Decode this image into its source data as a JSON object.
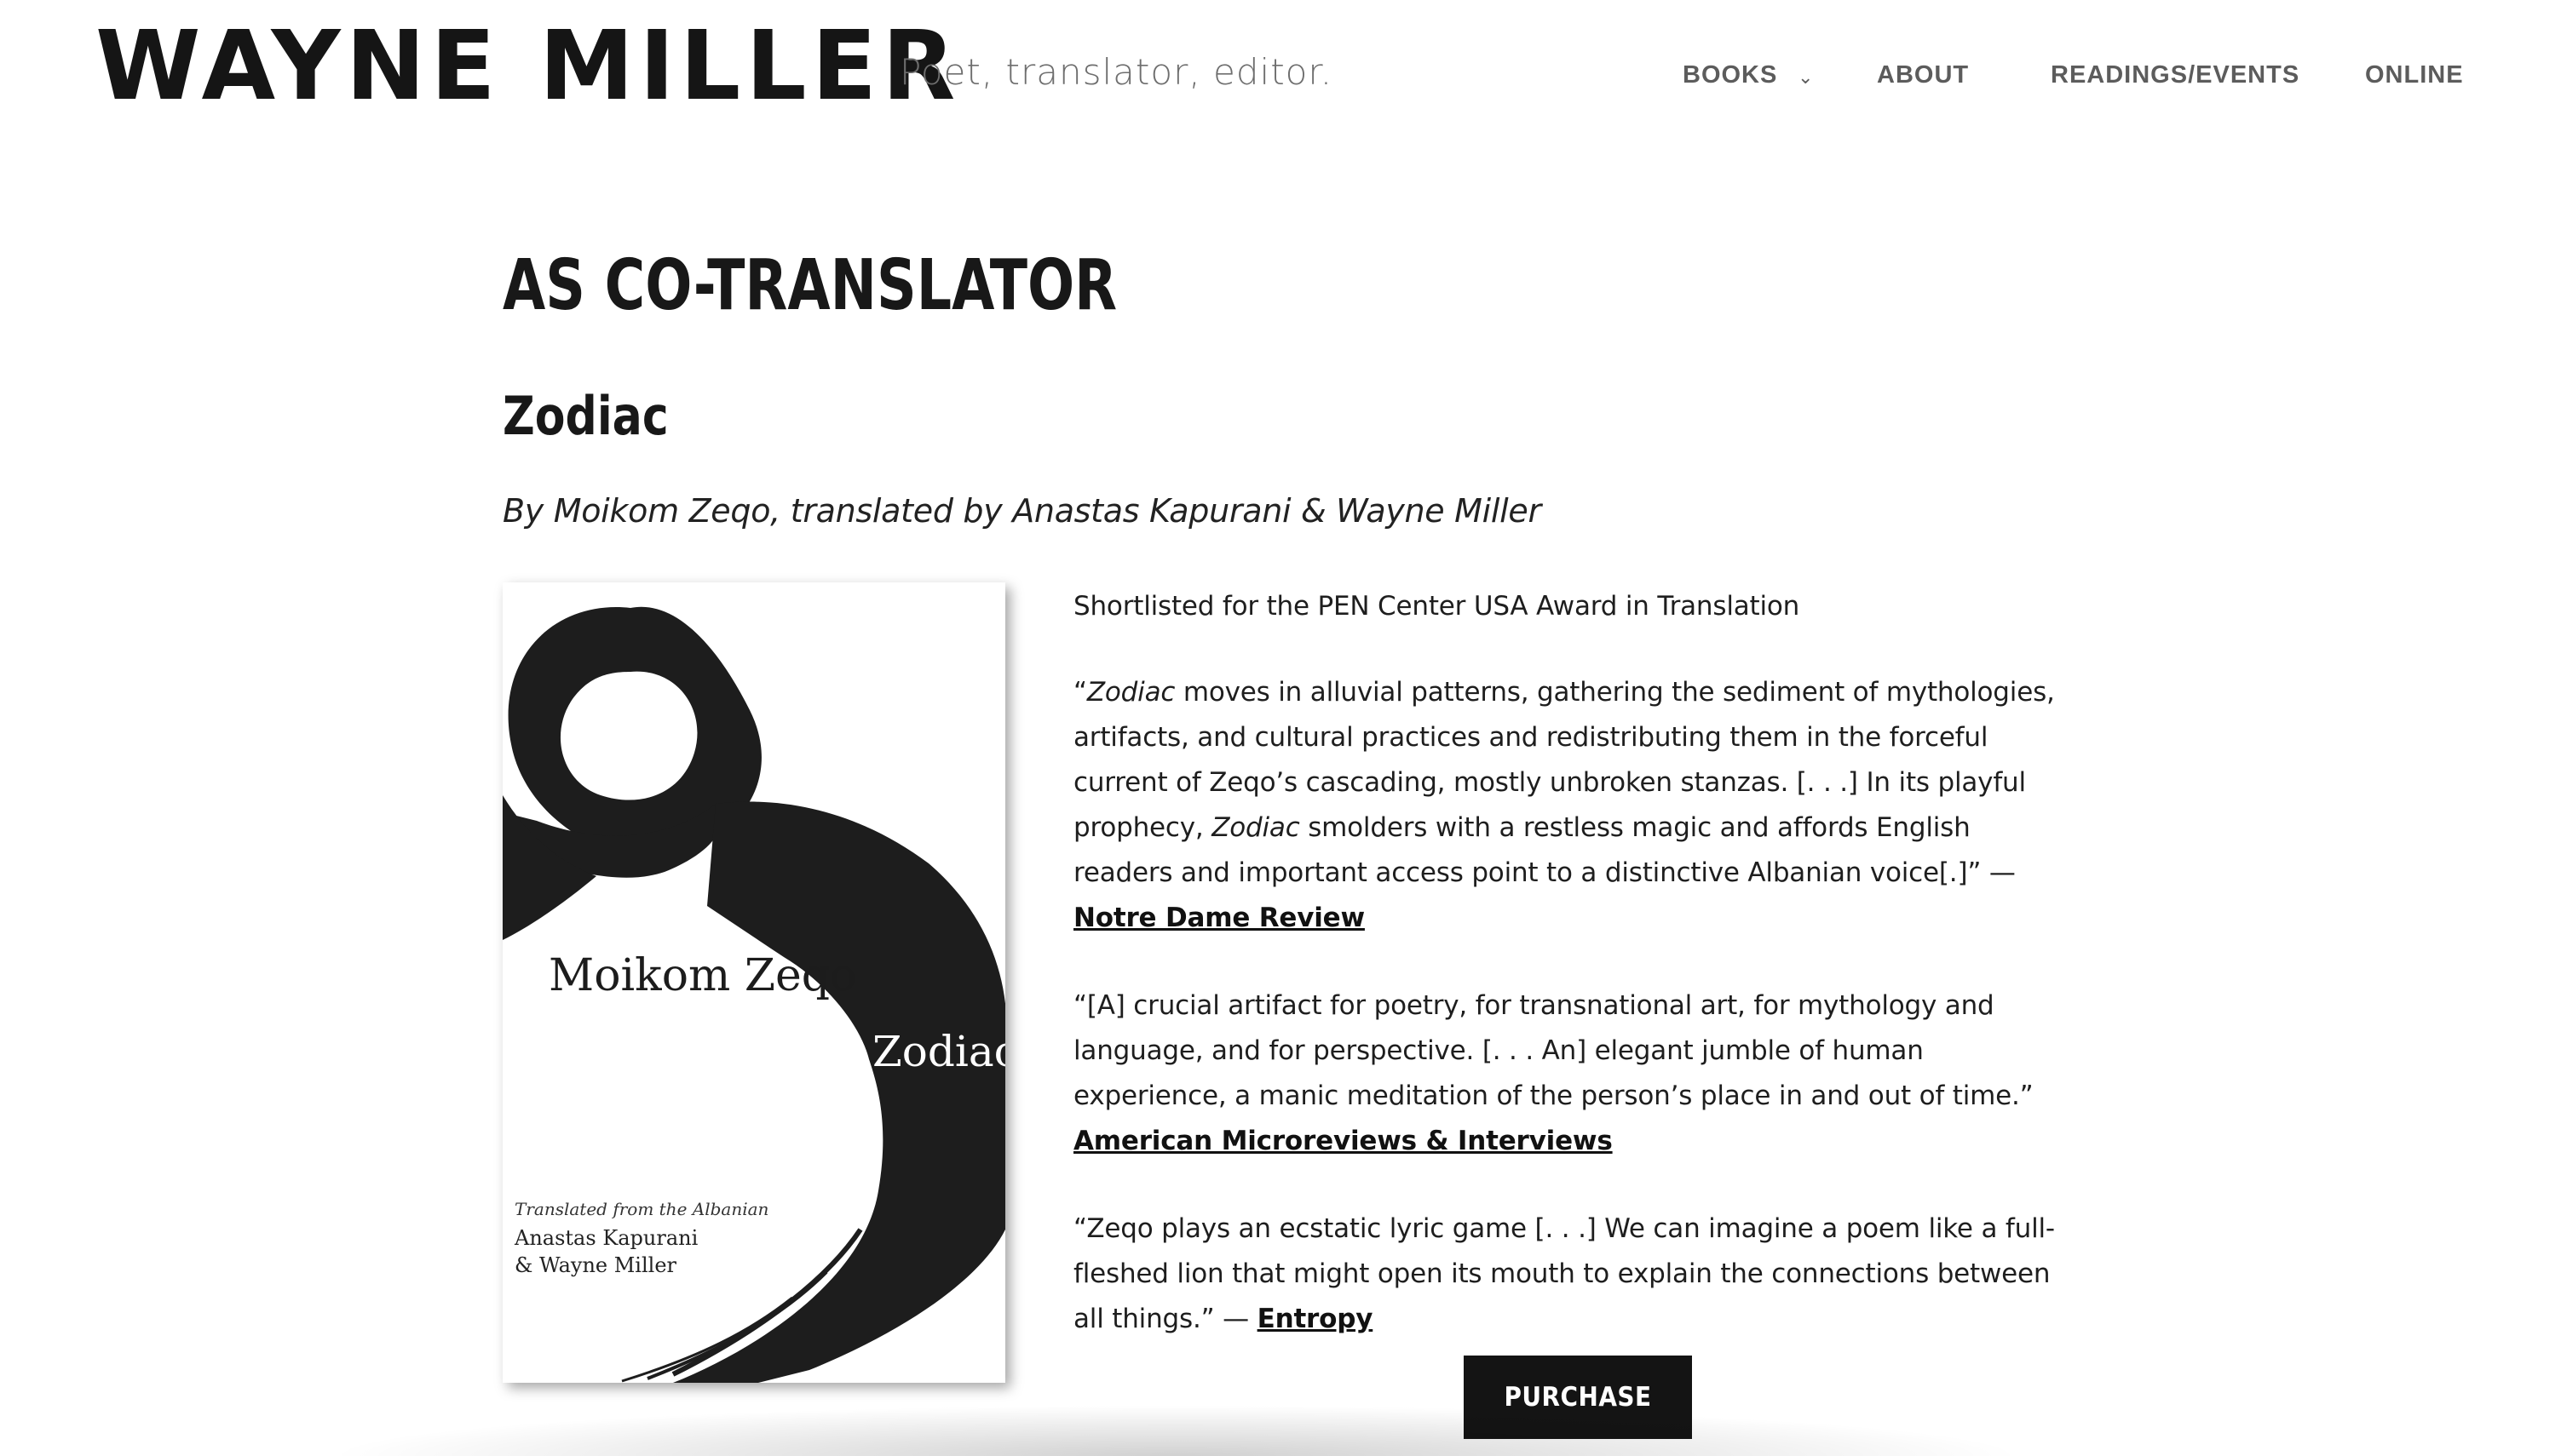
{
  "header": {
    "site_title": "WAYNE MILLER",
    "tagline": "Poet, translator, editor.",
    "nav": [
      {
        "label": "BOOKS",
        "has_dropdown": true
      },
      {
        "label": "ABOUT"
      },
      {
        "label": "READINGS/EVENTS"
      },
      {
        "label": "ONLINE"
      }
    ]
  },
  "main": {
    "section_heading": "AS CO-TRANSLATOR",
    "book_title": "Zodiac",
    "byline": "By Moikom Zeqo, translated by Anastas Kapurani & Wayne Miller",
    "cover": {
      "author": "Moikom Zeqo",
      "title": "Zodiac",
      "translated_from": "Translated from the Albanian",
      "translator1": "Anastas Kapurani",
      "translator2": "& Wayne Miller"
    },
    "award": "Shortlisted for the PEN Center USA Award in Translation",
    "reviews": [
      {
        "open": "“",
        "em": "Zodiac",
        "text1": " moves in alluvial patterns, gathering the sediment of mythologies, artifacts, and cultural practices and redistributing them in the forceful current of Zeqo’s cascading, mostly unbroken stanzas. [. . .] In its playful prophecy, ",
        "em2": "Zodiac",
        "text2": " smolders with a restless magic and affords English readers and important access point to a distinctive Albanian voice[.]” —",
        "source": "Notre Dame Review"
      },
      {
        "text": "“[A] crucial artifact for poetry, for transnational art, for mythology and language, and for perspective. [. . . An] elegant jumble of human experience, a manic meditation of the person’s place in and out of time.” ",
        "source": "American Microreviews & Interviews"
      },
      {
        "text": "“Zeqo plays an ecstatic lyric game [. . .] We can imagine a poem like a full-fleshed lion that might open its mouth to explain the connections between all things.” — ",
        "source": "Entropy"
      }
    ],
    "purchase_label": "PURCHASE"
  },
  "colors": {
    "text": "#1b1b1b",
    "nav": "#5c5c5c",
    "tagline": "#6e6e6e",
    "button_bg": "#141414",
    "button_text": "#ffffff"
  }
}
